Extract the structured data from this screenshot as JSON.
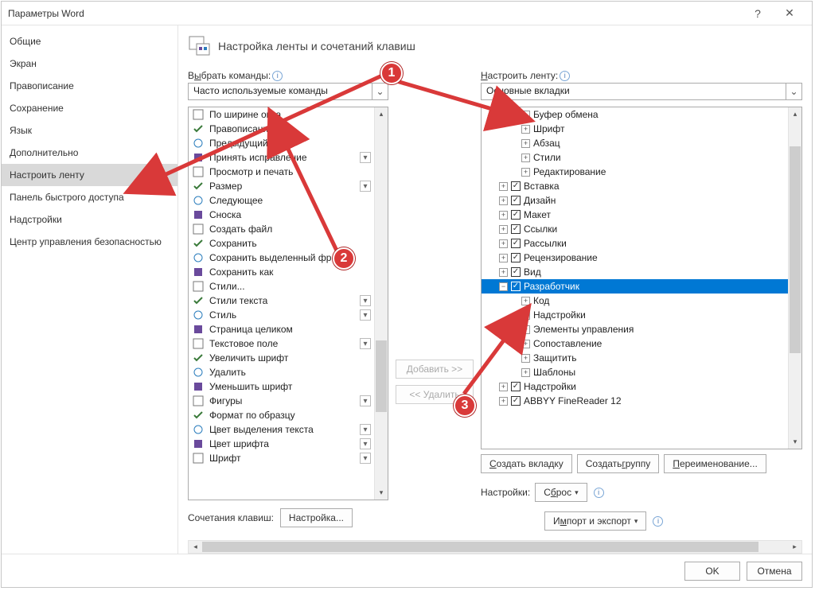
{
  "title": "Параметры Word",
  "titlebar": {
    "help": "?",
    "close": "✕"
  },
  "sidebar": {
    "items": [
      "Общие",
      "Экран",
      "Правописание",
      "Сохранение",
      "Язык",
      "Дополнительно",
      "Настроить ленту",
      "Панель быстрого доступа",
      "Надстройки",
      "Центр управления безопасностью"
    ],
    "selectedIndex": 6
  },
  "header": "Настройка ленты и сочетаний клавиш",
  "left": {
    "label_pre": "В",
    "label_u": "ы",
    "label_post": "брать команды:",
    "combo": "Часто используемые команды",
    "commands": [
      {
        "t": "По ширине окна",
        "d": false
      },
      {
        "t": "Правописание",
        "d": false
      },
      {
        "t": "Предыдущий",
        "d": false
      },
      {
        "t": "Принять исправление",
        "d": true
      },
      {
        "t": "Просмотр и печать",
        "d": false
      },
      {
        "t": "Размер",
        "d": true
      },
      {
        "t": "Следующее",
        "d": false
      },
      {
        "t": "Сноска",
        "d": false
      },
      {
        "t": "Создать файл",
        "d": false
      },
      {
        "t": "Сохранить",
        "d": false
      },
      {
        "t": "Сохранить выделенный фр...",
        "d": false
      },
      {
        "t": "Сохранить как",
        "d": false
      },
      {
        "t": "Стили...",
        "d": false
      },
      {
        "t": "Стили текста",
        "d": true
      },
      {
        "t": "Стиль",
        "d": true
      },
      {
        "t": "Страница целиком",
        "d": false
      },
      {
        "t": "Текстовое поле",
        "d": true
      },
      {
        "t": "Увеличить шрифт",
        "d": false
      },
      {
        "t": "Удалить",
        "d": false
      },
      {
        "t": "Уменьшить шрифт",
        "d": false
      },
      {
        "t": "Фигуры",
        "d": true
      },
      {
        "t": "Формат по образцу",
        "d": false
      },
      {
        "t": "Цвет выделения текста",
        "d": true
      },
      {
        "t": "Цвет шрифта",
        "d": true
      },
      {
        "t": "Шрифт",
        "d": true
      }
    ],
    "kb_label": "Сочетания клавиш:",
    "kb_button": "Настройка..."
  },
  "mid": {
    "add": "Добавить >>",
    "remove": "<< Удалить"
  },
  "right": {
    "label_u": "Н",
    "label_post": "астроить ленту:",
    "combo": "Основные вкладки",
    "tree": [
      {
        "ind": 3,
        "exp": "+",
        "chk": null,
        "t": "Буфер обмена"
      },
      {
        "ind": 3,
        "exp": "+",
        "chk": null,
        "t": "Шрифт"
      },
      {
        "ind": 3,
        "exp": "+",
        "chk": null,
        "t": "Абзац"
      },
      {
        "ind": 3,
        "exp": "+",
        "chk": null,
        "t": "Стили"
      },
      {
        "ind": 3,
        "exp": "+",
        "chk": null,
        "t": "Редактирование"
      },
      {
        "ind": 1,
        "exp": "+",
        "chk": true,
        "t": "Вставка"
      },
      {
        "ind": 1,
        "exp": "+",
        "chk": true,
        "t": "Дизайн"
      },
      {
        "ind": 1,
        "exp": "+",
        "chk": true,
        "t": "Макет"
      },
      {
        "ind": 1,
        "exp": "+",
        "chk": true,
        "t": "Ссылки"
      },
      {
        "ind": 1,
        "exp": "+",
        "chk": true,
        "t": "Рассылки"
      },
      {
        "ind": 1,
        "exp": "+",
        "chk": true,
        "t": "Рецензирование"
      },
      {
        "ind": 1,
        "exp": "+",
        "chk": true,
        "t": "Вид"
      },
      {
        "ind": 1,
        "exp": "−",
        "chk": true,
        "t": "Разработчик",
        "sel": true
      },
      {
        "ind": 3,
        "exp": "+",
        "chk": null,
        "t": "Код"
      },
      {
        "ind": 3,
        "exp": "+",
        "chk": null,
        "t": "Надстройки"
      },
      {
        "ind": 3,
        "exp": "+",
        "chk": null,
        "t": "Элементы управления"
      },
      {
        "ind": 3,
        "exp": "+",
        "chk": null,
        "t": "Сопоставление"
      },
      {
        "ind": 3,
        "exp": "+",
        "chk": null,
        "t": "Защитить"
      },
      {
        "ind": 3,
        "exp": "+",
        "chk": null,
        "t": "Шаблоны"
      },
      {
        "ind": 1,
        "exp": "+",
        "chk": true,
        "t": "Надстройки"
      },
      {
        "ind": 1,
        "exp": "+",
        "chk": true,
        "t": "ABBYY FineReader 12"
      }
    ],
    "btns": {
      "newtab_u": "С",
      "newtab": "оздать вкладку",
      "newgrp": "Создать ",
      "newgrp_u": "г",
      "newgrp2": "руппу",
      "rename_u": "П",
      "rename": "ереименование..."
    },
    "settings_label": "Настройки:",
    "reset_pre": "С",
    "reset_u": "б",
    "reset_post": "рос",
    "impexp_pre": "И",
    "impexp_u": "м",
    "impexp_post": "порт и экспорт"
  },
  "footer": {
    "ok": "OK",
    "cancel": "Отмена"
  },
  "callouts": {
    "c1": "1",
    "c2": "2",
    "c3": "3"
  }
}
